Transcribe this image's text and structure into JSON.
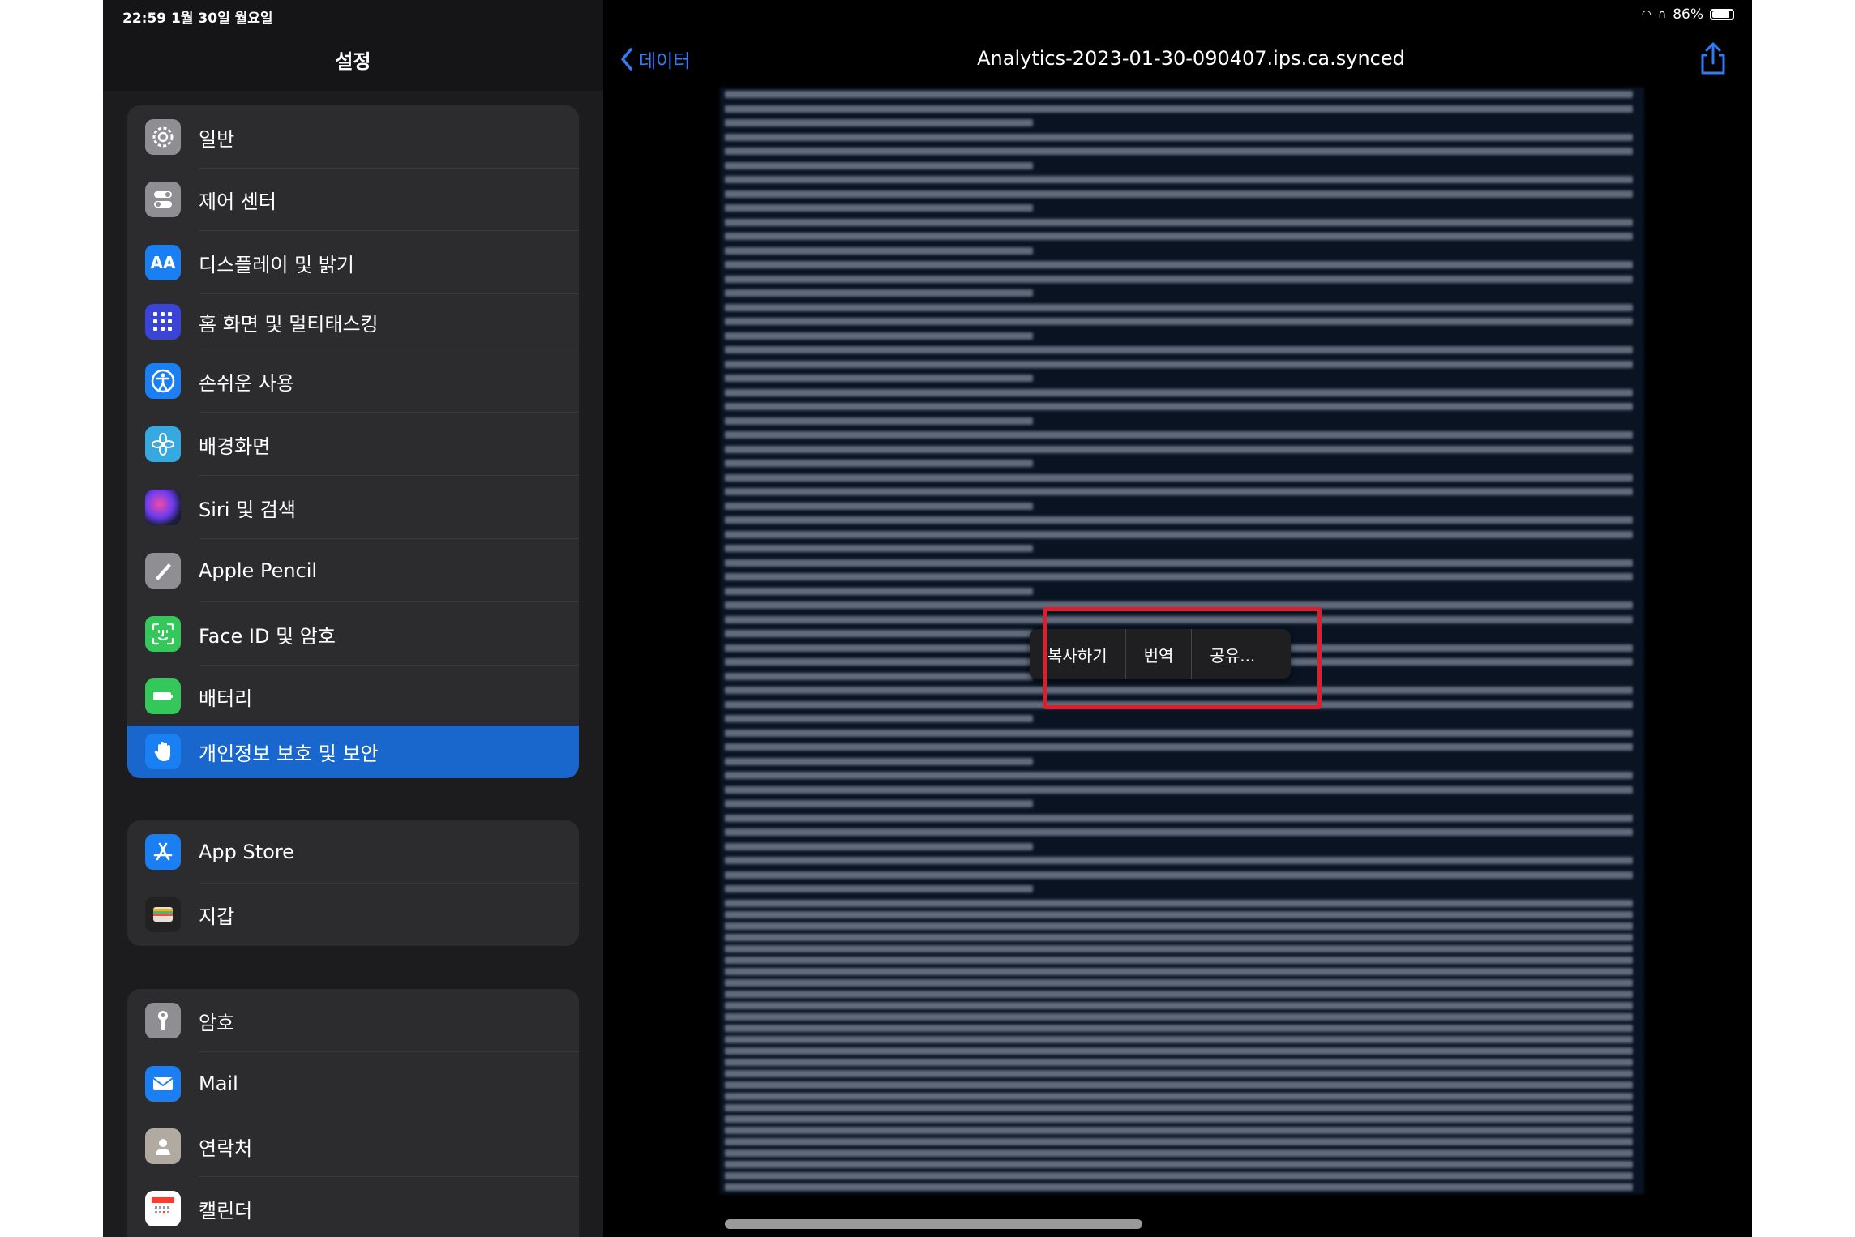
{
  "status": {
    "time_date": "22:59   1월 30일 월요일",
    "battery": "86%"
  },
  "sidebar": {
    "title": "설정",
    "groups": [
      {
        "items": [
          {
            "label": "일반",
            "icon": "gear-icon",
            "color": "#8e8e93"
          },
          {
            "label": "제어 센터",
            "icon": "toggles-icon",
            "color": "#8e8e93"
          },
          {
            "label": "디스플레이 및 밝기",
            "icon": "text-size-icon",
            "color": "#1a7ff2"
          },
          {
            "label": "홈 화면 및 멀티태스킹",
            "icon": "grid-icon",
            "color": "#3a44d6"
          },
          {
            "label": "손쉬운 사용",
            "icon": "accessibility-icon",
            "color": "#1a7ff2"
          },
          {
            "label": "배경화면",
            "icon": "flower-icon",
            "color": "#36a9e1"
          },
          {
            "label": "Siri 및 검색",
            "icon": "siri-icon",
            "color": "#222"
          },
          {
            "label": "Apple Pencil",
            "icon": "pencil-icon",
            "color": "#8e8e93"
          },
          {
            "label": "Face ID 및 암호",
            "icon": "face-id-icon",
            "color": "#34c759"
          },
          {
            "label": "배터리",
            "icon": "battery-icon",
            "color": "#34c759"
          },
          {
            "label": "개인정보 보호 및 보안",
            "icon": "hand-icon",
            "color": "#1a7ff2",
            "selected": true
          }
        ]
      },
      {
        "items": [
          {
            "label": "App Store",
            "icon": "app-store-icon",
            "color": "#1a7ff2"
          },
          {
            "label": "지갑",
            "icon": "wallet-icon",
            "color": "#222"
          }
        ]
      },
      {
        "items": [
          {
            "label": "암호",
            "icon": "key-icon",
            "color": "#8e8e93"
          },
          {
            "label": "Mail",
            "icon": "mail-icon",
            "color": "#1a7ff2"
          },
          {
            "label": "연락처",
            "icon": "contacts-icon",
            "color": "#b0aaa0"
          },
          {
            "label": "캘린더",
            "icon": "calendar-icon",
            "color": "#ffffff"
          }
        ]
      }
    ]
  },
  "detail": {
    "back_label": "데이터",
    "title": "Analytics-2023-01-30-090407.ips.ca.synced",
    "context_menu": [
      "복사하기",
      "번역",
      "공유..."
    ],
    "accent": "#2f7cf6",
    "highlight_color": "#e11d2b"
  }
}
